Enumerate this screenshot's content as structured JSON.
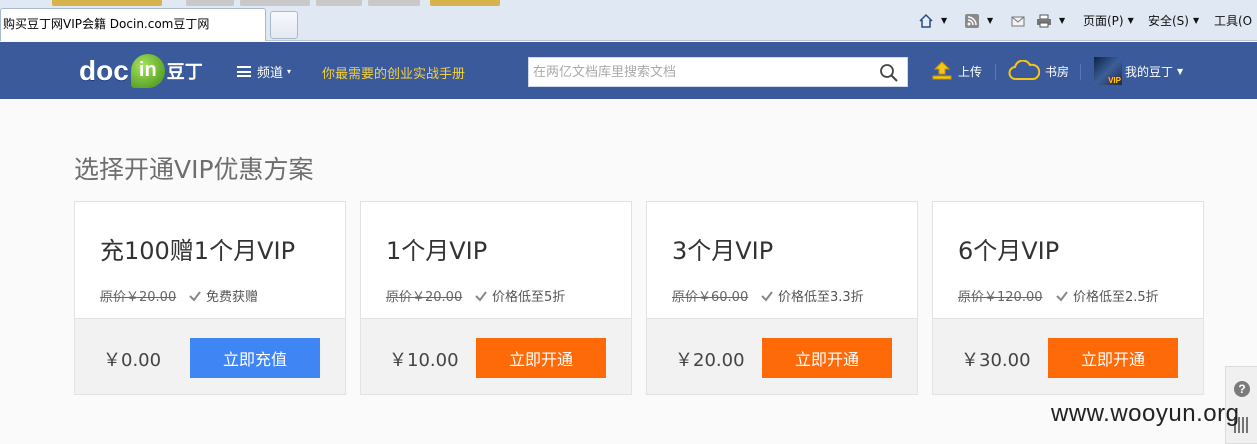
{
  "browser": {
    "tab_title": "购买豆丁网VIP会籍 Docin.com豆丁网",
    "commands": {
      "page": "页面(P)",
      "safety": "安全(S)",
      "tools": "工具(O"
    }
  },
  "header": {
    "logo_text": "doc",
    "logo_in": "in",
    "logo_cn": "豆丁",
    "channel_label": "频道",
    "slogan": "你最需要的创业实战手册",
    "search_placeholder": "在两亿文档库里搜索文档",
    "upload_label": "上传",
    "bookroom_label": "书房",
    "account_label": "我的豆丁",
    "avatar_badge": "VIP"
  },
  "main": {
    "title": "选择开通VIP优惠方案",
    "plans": [
      {
        "name": "充100赠1个月VIP",
        "original_price": "原价￥20.00",
        "tag": "免费获赠",
        "price": "￥0.00",
        "button": "立即充值",
        "button_color": "#3f86f4"
      },
      {
        "name": "1个月VIP",
        "original_price": "原价￥20.00",
        "tag": "价格低至5折",
        "price": "￥10.00",
        "button": "立即开通",
        "button_color": "#ff6a08"
      },
      {
        "name": "3个月VIP",
        "original_price": "原价￥60.00",
        "tag": "价格低至3.3折",
        "price": "￥20.00",
        "button": "立即开通",
        "button_color": "#ff6a08"
      },
      {
        "name": "6个月VIP",
        "original_price": "原价￥120.00",
        "tag": "价格低至2.5折",
        "price": "￥30.00",
        "button": "立即开通",
        "button_color": "#ff6a08"
      }
    ]
  },
  "side": {
    "help_glyph": "?"
  },
  "watermark": "www.wooyun.org"
}
